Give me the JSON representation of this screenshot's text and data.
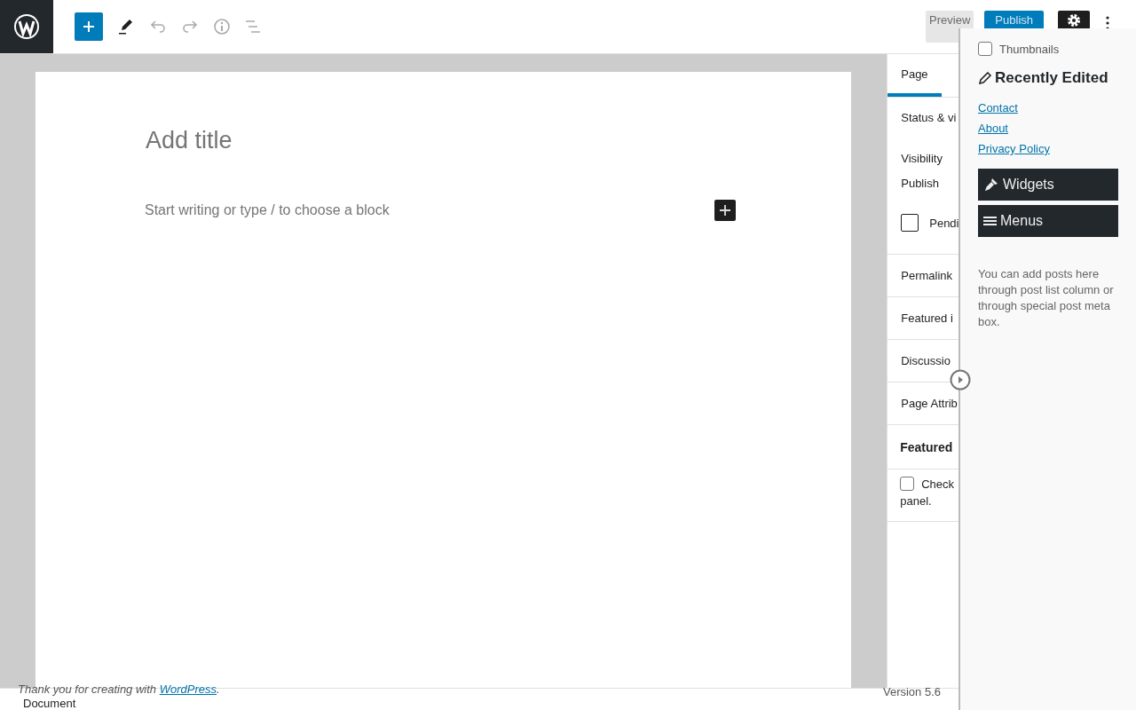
{
  "top_bar": {
    "preview": "Preview",
    "publish": "Publish"
  },
  "editor": {
    "title_placeholder": "Add title",
    "body_placeholder": "Start writing or type / to choose a block"
  },
  "sidebar": {
    "tabs": [
      {
        "label": "Page",
        "selected": true
      }
    ],
    "status_panel": {
      "title": "Status & vi",
      "rows": [
        {
          "kind": "text",
          "label": "Visibility"
        },
        {
          "kind": "text",
          "label": "Publish"
        },
        {
          "kind": "checkbox",
          "label": "Pendi",
          "checked": false
        }
      ]
    },
    "panels": [
      "Permalink",
      "Featured i",
      "Discussio",
      "Page Attrib"
    ],
    "featured": {
      "title": "Featured",
      "checkbox": {
        "label": "Check",
        "checked": false
      },
      "continuation": "panel."
    }
  },
  "overlay": {
    "thumbnails": {
      "label": "Thumbnails",
      "checked": false
    },
    "heading": "Recently Edited",
    "links": [
      "Contact",
      "About",
      "Privacy Policy"
    ],
    "menus": [
      {
        "kind": "widgets",
        "label": "Widgets"
      },
      {
        "kind": "menus",
        "label": "Menus"
      }
    ],
    "note": "You can add posts here through post list column or through special post meta box."
  },
  "footer": {
    "thanks": "Thank you for creating with ",
    "link": "WordPress",
    "end": ".",
    "version": "Version 5.6",
    "document": "Document"
  }
}
